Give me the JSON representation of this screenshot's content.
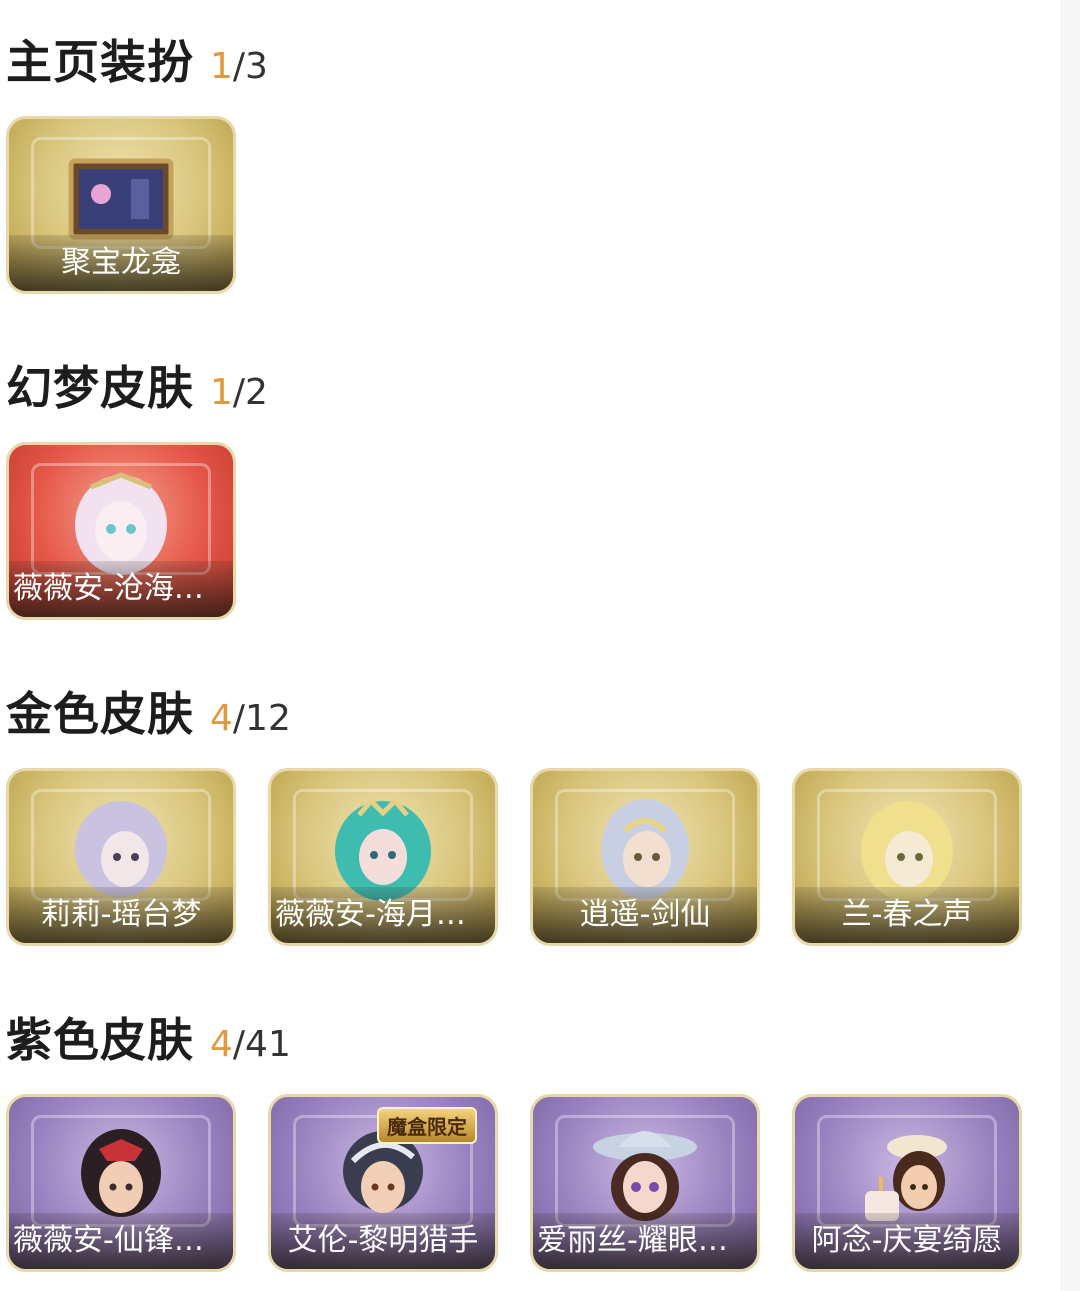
{
  "sections": [
    {
      "title": "主页装扮",
      "owned": "1",
      "total": "/3",
      "items": [
        {
          "label": "聚宝龙龛",
          "rarity": "gold",
          "icon": "picture-frame-icon"
        }
      ]
    },
    {
      "title": "幻梦皮肤",
      "owned": "1",
      "total": "/2",
      "items": [
        {
          "label": "薇薇安-沧海之…",
          "rarity": "red",
          "icon": "character-portrait-icon"
        }
      ]
    },
    {
      "title": "金色皮肤",
      "owned": "4",
      "total": "/12",
      "items": [
        {
          "label": "莉莉-瑶台梦",
          "rarity": "gold",
          "icon": "character-portrait-icon"
        },
        {
          "label": "薇薇安-海月息…",
          "rarity": "gold",
          "icon": "character-portrait-icon"
        },
        {
          "label": "逍遥-剑仙",
          "rarity": "gold",
          "icon": "character-portrait-icon"
        },
        {
          "label": "兰-春之声",
          "rarity": "gold",
          "icon": "character-portrait-icon"
        }
      ]
    },
    {
      "title": "紫色皮肤",
      "owned": "4",
      "total": "/41",
      "items": [
        {
          "label": "薇薇安-仙锋小…",
          "rarity": "purple",
          "icon": "character-portrait-icon"
        },
        {
          "label": "艾伦-黎明猎手",
          "rarity": "purple",
          "icon": "character-portrait-icon",
          "badge": "魔盒限定"
        },
        {
          "label": "爱丽丝-耀眼的…",
          "rarity": "purple",
          "icon": "character-portrait-icon"
        },
        {
          "label": "阿念-庆宴绮愿",
          "rarity": "purple",
          "icon": "character-portrait-icon"
        }
      ]
    }
  ],
  "colors": {
    "owned_count": "#e09a3c",
    "title": "#1d1d1f",
    "card_border": "#e8d7a8"
  }
}
